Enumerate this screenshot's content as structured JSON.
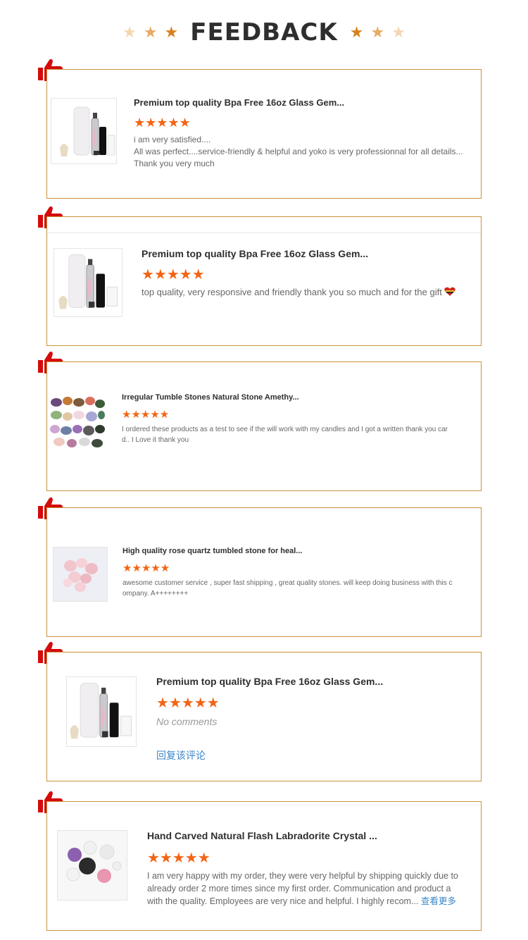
{
  "header": {
    "title": "FEEDBACK",
    "star_glyph": "★",
    "star_colors": [
      "#f3d7b0",
      "#e6aa62",
      "#d6801e"
    ]
  },
  "colors": {
    "card_border": "#c9933a",
    "star_rating": "#f26515",
    "thumb_icon": "#d40b0b",
    "link": "#3a86c8"
  },
  "reviews": [
    {
      "product_title": "Premium top quality Bpa Free 16oz Glass Gem...",
      "rating": 5,
      "stars": "★★★★★",
      "text": "i am very satisfied....\nAll was perfect....service-friendly & helpful and yoko is very professionnal for all details...\nThank you very much",
      "image_icon": "glass-bottle-product-icon"
    },
    {
      "product_title": "Premium top quality Bpa Free 16oz Glass Gem...",
      "rating": 5,
      "stars": "★★★★★",
      "text": "top quality, very responsive and friendly thank you so much and for the gift",
      "emoji": "heart-flag-icon",
      "image_icon": "glass-bottle-product-icon"
    },
    {
      "product_title": "Irregular Tumble Stones Natural Stone Amethy...",
      "rating": 5,
      "stars": "★★★★★",
      "text": "I ordered these products as a test to see if the will work with my candles and I got a written thank you car\nd.. I Love it thank you",
      "image_icon": "tumble-stones-product-icon"
    },
    {
      "product_title": "High quality rose quartz tumbled stone for heal...",
      "rating": 5,
      "stars": "★★★★★",
      "text": "awesome customer service , super fast shipping , great quality stones. will keep doing business with this c\nompany. A++++++++",
      "image_icon": "rose-quartz-product-icon"
    },
    {
      "product_title": "Premium top quality Bpa Free 16oz Glass Gem...",
      "rating": 5,
      "stars": "★★★★★",
      "text": "No comments",
      "reply_label": "回复该评论",
      "image_icon": "glass-bottle-product-icon"
    },
    {
      "product_title": "Hand Carved Natural Flash Labradorite Crystal ...",
      "rating": 5,
      "stars": "★★★★★",
      "text": "I am very happy with my order, they were very helpful by shipping quickly due to\nalready order 2 more times since my first order. Communication and product a\nwith the quality. Employees are very nice and helpful. I highly recom...",
      "more_label": "查看更多",
      "image_icon": "crystal-spheres-product-icon"
    }
  ]
}
